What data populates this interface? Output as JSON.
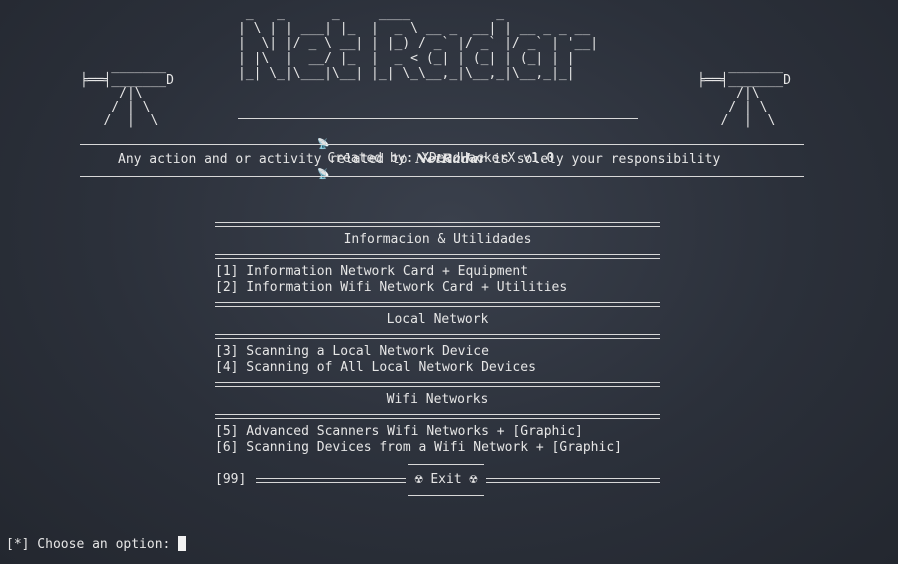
{
  "banner": {
    "logo_ascii": " _   _      _     ____           _           \n| \\ | | ___| |_  |  _ \\ __ _  __| | __ _ _ __ \n|  \\| |/ _ \\ __| | |_) / _` |/ _` |/ _` | '__|\n| |\\  |  __/ |_  |  _ < (_| | (_| | (_| | |   \n|_| \\_|\\___|\\__| |_| \\_\\__,_|\\__,_|\\__,_|_|   ",
    "antenna_ascii": "    _______\n╞══╡_______D\n     /|\\\n    / | \\\n   /  |  \\",
    "credit_icon": "satellite-antenna-icon",
    "credit": "Created by: XDeadHackerX v1.0",
    "disclaimer_prefix": "Any action and or activity related to ",
    "disclaimer_brand": "NetRadar",
    "disclaimer_suffix": " is solely your responsibility"
  },
  "menu": {
    "sections": [
      {
        "title": "Informacion & Utilidades",
        "items": [
          "[1] Information Network Card + Equipment",
          "[2] Information Wifi Network Card + Utilities"
        ]
      },
      {
        "title": "Local Network",
        "items": [
          "[3] Scanning a Local Network Device",
          "[4] Scanning of All Local Network Devices"
        ]
      },
      {
        "title": "Wifi Networks",
        "items": [
          "[5] Advanced Scanners Wifi Networks + [Graphic]",
          "[6] Scanning Devices from a Wifi Network + [Graphic]"
        ]
      }
    ],
    "exit_number": "[99]",
    "exit_label": "☢ Exit ☢"
  },
  "prompt": {
    "text": "[*] Choose an option: "
  }
}
